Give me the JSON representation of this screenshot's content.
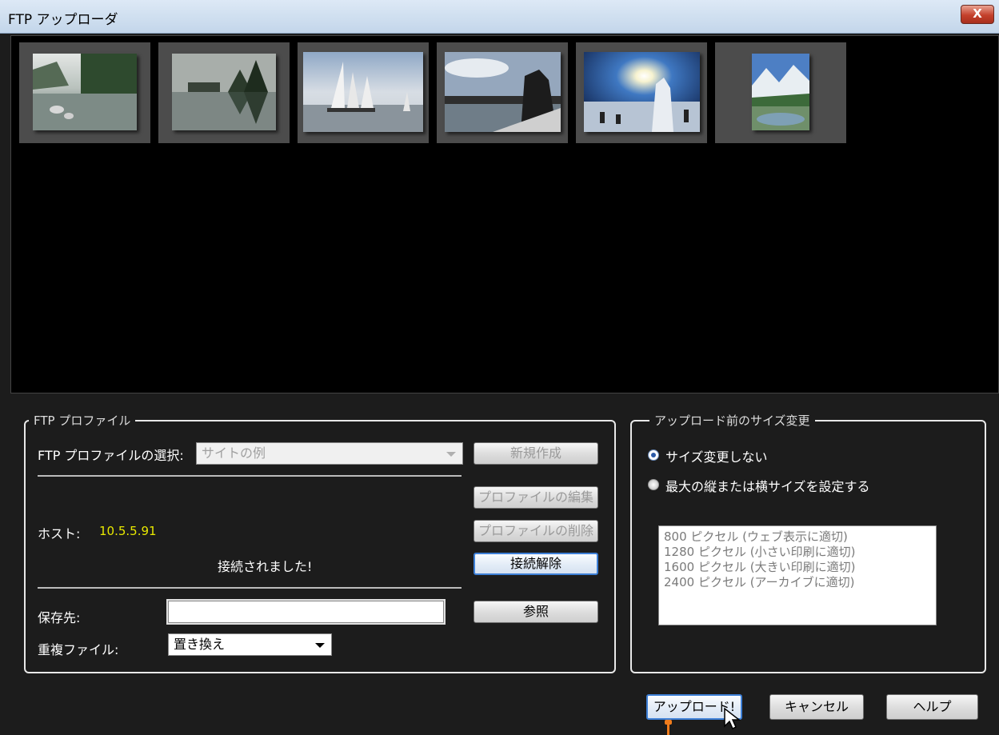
{
  "window": {
    "title": "FTP アップローダ",
    "close_label": "X"
  },
  "gallery": {
    "thumbnails": [
      {
        "name": "mountain-lake-fog"
      },
      {
        "name": "lake-house-reflection"
      },
      {
        "name": "sailboat"
      },
      {
        "name": "city-statue"
      },
      {
        "name": "snow-sun-people"
      },
      {
        "name": "alpine-lake"
      }
    ]
  },
  "ftp_profile": {
    "legend": "FTP プロファイル",
    "select_label": "FTP プロファイルの選択:",
    "select_value": "サイトの例",
    "new_button": "新規作成",
    "edit_button": "プロファイルの編集",
    "delete_button": "プロファイルの削除",
    "host_label": "ホスト:",
    "host_value": "10.5.5.91",
    "status": "接続されました!",
    "disconnect_button": "接続解除",
    "dest_label": "保存先:",
    "dest_value": "",
    "browse_button": "参照",
    "dup_label": "重複ファイル:",
    "dup_value": "置き換え"
  },
  "resize": {
    "legend": "アップロード前のサイズ変更",
    "option_no_resize": "サイズ変更しない",
    "option_max_size": "最大の縦または横サイズを設定する",
    "sizes": [
      "800 ピクセル (ウェブ表示に適切)",
      "1280 ピクセル (小さい印刷に適切)",
      "1600 ピクセル (大きい印刷に適切)",
      "2400 ピクセル (アーカイブに適切)"
    ]
  },
  "footer": {
    "upload_button": "アップロード!",
    "cancel_button": "キャンセル",
    "help_button": "ヘルプ"
  },
  "colors": {
    "host_value": "#e8e800",
    "focus_border": "#3d7fd6",
    "marker": "#f07c1c"
  }
}
